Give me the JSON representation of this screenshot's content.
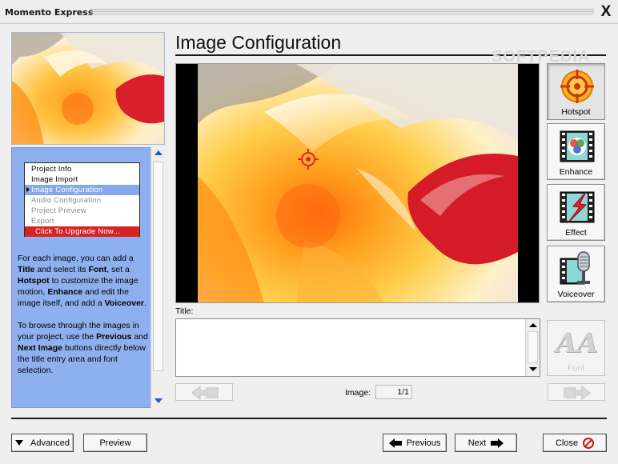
{
  "window": {
    "title": "Momento Express",
    "close_glyph": "X"
  },
  "sidebar": {
    "nav": [
      {
        "label": "Project Info",
        "state": "normal"
      },
      {
        "label": "Image Import",
        "state": "normal"
      },
      {
        "label": "Image Configuration",
        "state": "active"
      },
      {
        "label": "Audio Configuration",
        "state": "disabled"
      },
      {
        "label": "Project Preview",
        "state": "disabled"
      },
      {
        "label": "Export",
        "state": "disabled"
      },
      {
        "label": "Click To Upgrade Now...",
        "state": "upgrade"
      }
    ],
    "help": {
      "p1": [
        {
          "t": "For each image, you can add a ",
          "b": false
        },
        {
          "t": "Title",
          "b": true
        },
        {
          "t": " and select its ",
          "b": false
        },
        {
          "t": "Font",
          "b": true
        },
        {
          "t": ", set a ",
          "b": false
        },
        {
          "t": "Hotspot",
          "b": true
        },
        {
          "t": " to customize the image motion, ",
          "b": false
        },
        {
          "t": "Enhance",
          "b": true
        },
        {
          "t": " and edit the image itself, and add a ",
          "b": false
        },
        {
          "t": "Voiceover",
          "b": true
        },
        {
          "t": ".",
          "b": false
        }
      ],
      "p2": [
        {
          "t": "To browse through the images in your project, use the ",
          "b": false
        },
        {
          "t": "Previous",
          "b": true
        },
        {
          "t": " and ",
          "b": false
        },
        {
          "t": "Next Image",
          "b": true
        },
        {
          "t": " buttons directly below the title entry area and font selection.",
          "b": false
        }
      ]
    }
  },
  "main": {
    "heading": "Image Configuration",
    "watermark": "SOFTPEDIA",
    "title_label": "Title:",
    "title_value": "",
    "image_label": "Image:",
    "image_counter": "1/1"
  },
  "tools": {
    "hotspot": "Hotspot",
    "enhance": "Enhance",
    "effect": "Effect",
    "voiceover": "Voiceover",
    "font": "Font",
    "font_glyph": "AA"
  },
  "footer": {
    "advanced": "Advanced",
    "preview": "Preview",
    "previous": "Previous",
    "next": "Next",
    "close": "Close"
  },
  "colors": {
    "help_panel": "#8fb0ee",
    "nav_active": "#86a7ea",
    "nav_upgrade": "#d62424",
    "accent_blue": "#1b5cc4"
  },
  "icons": {
    "hotspot": "crosshair-target-icon",
    "enhance": "film-color-palette-icon",
    "effect": "film-lightning-icon",
    "voiceover": "film-microphone-icon",
    "font": "double-letter-icon",
    "close": "no-sign-icon"
  }
}
